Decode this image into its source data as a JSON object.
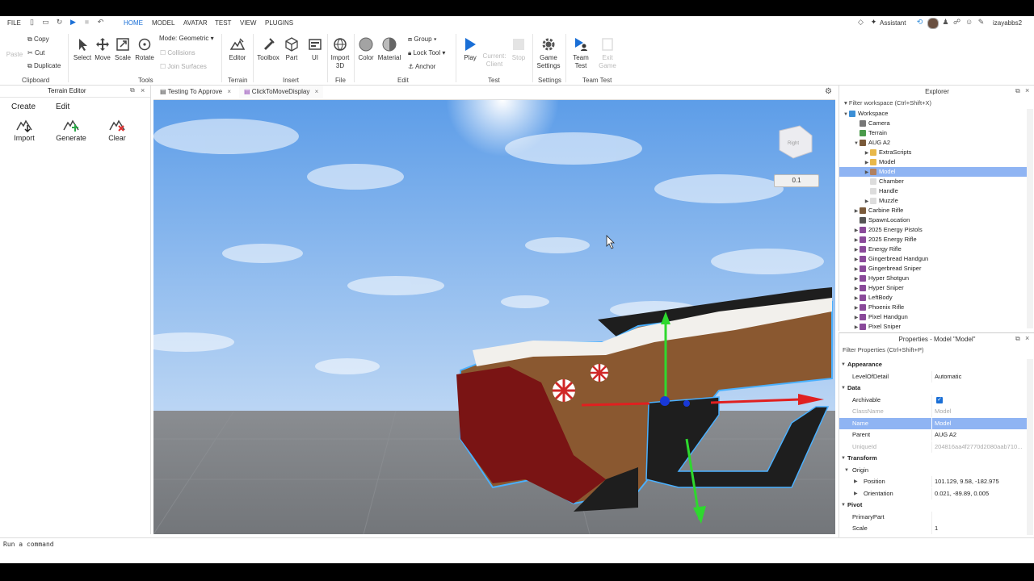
{
  "menubar": {
    "file": "FILE",
    "tabs": [
      "HOME",
      "MODEL",
      "AVATAR",
      "TEST",
      "VIEW",
      "PLUGINS"
    ],
    "assistant": "Assistant",
    "username": "izayabbs2"
  },
  "ribbon": {
    "clipboard": {
      "paste": "Paste",
      "copy": "Copy",
      "cut": "Cut",
      "duplicate": "Duplicate",
      "group": "Clipboard"
    },
    "tools": {
      "select": "Select",
      "move": "Move",
      "scale": "Scale",
      "rotate": "Rotate",
      "mode_label": "Mode:",
      "mode_value": "Geometric",
      "collisions": "Collisions",
      "join_surfaces": "Join Surfaces",
      "group": "Tools"
    },
    "terrain": {
      "editor": "Editor",
      "group": "Terrain"
    },
    "insert": {
      "toolbox": "Toolbox",
      "part": "Part",
      "ui": "UI",
      "group": "Insert"
    },
    "file": {
      "import3d": "Import 3D",
      "group": "File"
    },
    "edit": {
      "color": "Color",
      "material": "Material",
      "group_btn": "Group",
      "lock_tool": "Lock Tool",
      "anchor": "Anchor",
      "group": "Edit"
    },
    "test": {
      "play": "Play",
      "current_client": "Current: Client",
      "stop": "Stop",
      "group": "Test"
    },
    "settings": {
      "game_settings": "Game Settings",
      "group": "Settings"
    },
    "team_test": {
      "team_test": "Team Test",
      "exit_game": "Exit Game",
      "group": "Team Test"
    }
  },
  "terrain_editor": {
    "title": "Terrain Editor",
    "tabs": [
      "Create",
      "Edit"
    ],
    "buttons": [
      "Import",
      "Generate",
      "Clear"
    ]
  },
  "doc_tabs": [
    "Testing To Approve",
    "ClickToMoveDisplay"
  ],
  "viewport": {
    "scale_value": "0.1",
    "view_cube_label": "Right"
  },
  "explorer": {
    "title": "Explorer",
    "filter": "Filter workspace (Ctrl+Shift+X)",
    "items": [
      {
        "label": "Workspace",
        "depth": 0,
        "expanded": true,
        "icon": "workspace-icon",
        "color": "#3c8fd6"
      },
      {
        "label": "Camera",
        "depth": 1,
        "icon": "camera-icon",
        "color": "#777777"
      },
      {
        "label": "Terrain",
        "depth": 1,
        "icon": "terrain-icon",
        "color": "#4a9a4a"
      },
      {
        "label": "AUG A2",
        "depth": 1,
        "expanded": true,
        "icon": "model-icon",
        "color": "#7a5a3a"
      },
      {
        "label": "ExtraScripts",
        "depth": 2,
        "collapsed": true,
        "icon": "folder-icon",
        "color": "#e8b84a"
      },
      {
        "label": "Model",
        "depth": 2,
        "collapsed": true,
        "icon": "folder-icon",
        "color": "#e8b84a"
      },
      {
        "label": "Model",
        "depth": 2,
        "collapsed": true,
        "selected": true,
        "icon": "model-icon",
        "color": "#b08060"
      },
      {
        "label": "Chamber",
        "depth": 2,
        "icon": "part-icon",
        "color": "#dddddd"
      },
      {
        "label": "Handle",
        "depth": 2,
        "icon": "part-icon",
        "color": "#dddddd"
      },
      {
        "label": "Muzzle",
        "depth": 2,
        "collapsed": true,
        "icon": "part-icon",
        "color": "#dddddd"
      },
      {
        "label": "Carbine Rifle",
        "depth": 1,
        "collapsed": true,
        "icon": "model-icon",
        "color": "#7a5a3a"
      },
      {
        "label": "SpawnLocation",
        "depth": 1,
        "icon": "spawn-icon",
        "color": "#555555"
      },
      {
        "label": "2025 Energy Pistols",
        "depth": 1,
        "collapsed": true,
        "icon": "model-icon",
        "color": "#8a4a9a"
      },
      {
        "label": "2025 Energy Rifle",
        "depth": 1,
        "collapsed": true,
        "icon": "model-icon",
        "color": "#8a4a9a"
      },
      {
        "label": "Energy Rifle",
        "depth": 1,
        "collapsed": true,
        "icon": "model-icon",
        "color": "#8a4a9a"
      },
      {
        "label": "Gingerbread Handgun",
        "depth": 1,
        "collapsed": true,
        "icon": "model-icon",
        "color": "#8a4a9a"
      },
      {
        "label": "Gingerbread Sniper",
        "depth": 1,
        "collapsed": true,
        "icon": "model-icon",
        "color": "#8a4a9a"
      },
      {
        "label": "Hyper Shotgun",
        "depth": 1,
        "collapsed": true,
        "icon": "model-icon",
        "color": "#8a4a9a"
      },
      {
        "label": "Hyper Sniper",
        "depth": 1,
        "collapsed": true,
        "icon": "model-icon",
        "color": "#8a4a9a"
      },
      {
        "label": "LeftBody",
        "depth": 1,
        "collapsed": true,
        "icon": "model-icon",
        "color": "#8a4a9a"
      },
      {
        "label": "Phoenix Rifle",
        "depth": 1,
        "collapsed": true,
        "icon": "model-icon",
        "color": "#8a4a9a"
      },
      {
        "label": "Pixel Handgun",
        "depth": 1,
        "collapsed": true,
        "icon": "model-icon",
        "color": "#8a4a9a"
      },
      {
        "label": "Pixel Sniper",
        "depth": 1,
        "collapsed": true,
        "icon": "model-icon",
        "color": "#8a4a9a"
      }
    ]
  },
  "properties": {
    "title": "Properties - Model \"Model\"",
    "filter": "Filter Properties (Ctrl+Shift+P)",
    "rows": [
      {
        "type": "section",
        "key": "Appearance"
      },
      {
        "key": "LevelOfDetail",
        "value": "Automatic"
      },
      {
        "type": "section",
        "key": "Data"
      },
      {
        "key": "Archivable",
        "value": "",
        "checkbox": true
      },
      {
        "key": "ClassName",
        "value": "Model",
        "dim": true
      },
      {
        "key": "Name",
        "value": "Model",
        "selected": true
      },
      {
        "key": "Parent",
        "value": "AUG A2"
      },
      {
        "key": "UniqueId",
        "value": "204816aa4f2770d2080aab710...",
        "dim": true
      },
      {
        "type": "section",
        "key": "Transform"
      },
      {
        "type": "subsection",
        "key": "Origin"
      },
      {
        "key": "Position",
        "value": "101.129, 9.58, -182.975",
        "indent": true
      },
      {
        "key": "Orientation",
        "value": "0.021, -89.89, 0.005",
        "indent": true
      },
      {
        "type": "section",
        "key": "Pivot"
      },
      {
        "key": "PrimaryPart",
        "value": ""
      },
      {
        "key": "Scale",
        "value": "1"
      }
    ]
  },
  "command_bar": {
    "placeholder": "Run a command"
  },
  "colors": {
    "accent": "#1a6fd6",
    "selection": "#8fb4f3",
    "sky_top": "#5f9fe8",
    "sky_bottom": "#b8d4f5",
    "floor": "#7c7f84"
  }
}
